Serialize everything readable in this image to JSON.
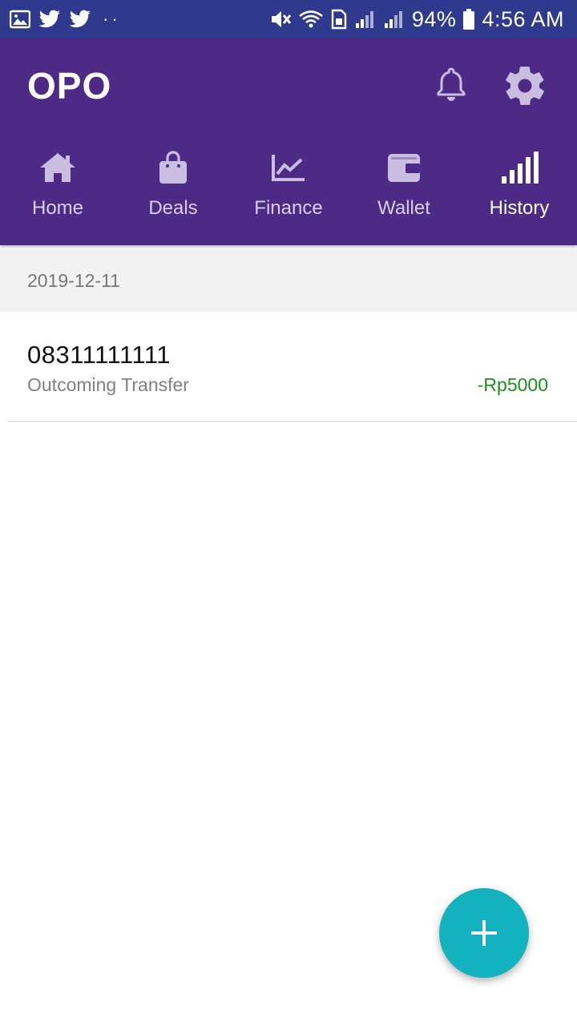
{
  "status_bar": {
    "icons": [
      "gallery-icon",
      "twitter-icon",
      "twitter-icon",
      "more-dots-icon",
      "mute-icon",
      "wifi-icon",
      "sim-icon",
      "signal-icon",
      "signal-icon",
      "battery-icon"
    ],
    "dots": "··",
    "battery": "94%",
    "time": "4:56 AM"
  },
  "app_bar": {
    "title": "OPO",
    "color": "#4c2a86",
    "actions": [
      "bell-icon",
      "gear-icon"
    ]
  },
  "tabs": [
    {
      "label": "Home",
      "icon": "home-icon",
      "active": false
    },
    {
      "label": "Deals",
      "icon": "shopping-bag-icon",
      "active": false
    },
    {
      "label": "Finance",
      "icon": "chart-icon",
      "active": false
    },
    {
      "label": "Wallet",
      "icon": "wallet-icon",
      "active": false
    },
    {
      "label": "History",
      "icon": "bars-icon",
      "active": true
    }
  ],
  "history": {
    "groups": [
      {
        "date": "2019-12-11",
        "transactions": [
          {
            "phone": "08311111111",
            "type": "Outcoming Transfer",
            "amount": "-Rp5000",
            "amount_color": "#1a8f1a"
          }
        ]
      }
    ]
  },
  "fab": {
    "icon": "plus-icon",
    "color": "#12b3be"
  }
}
